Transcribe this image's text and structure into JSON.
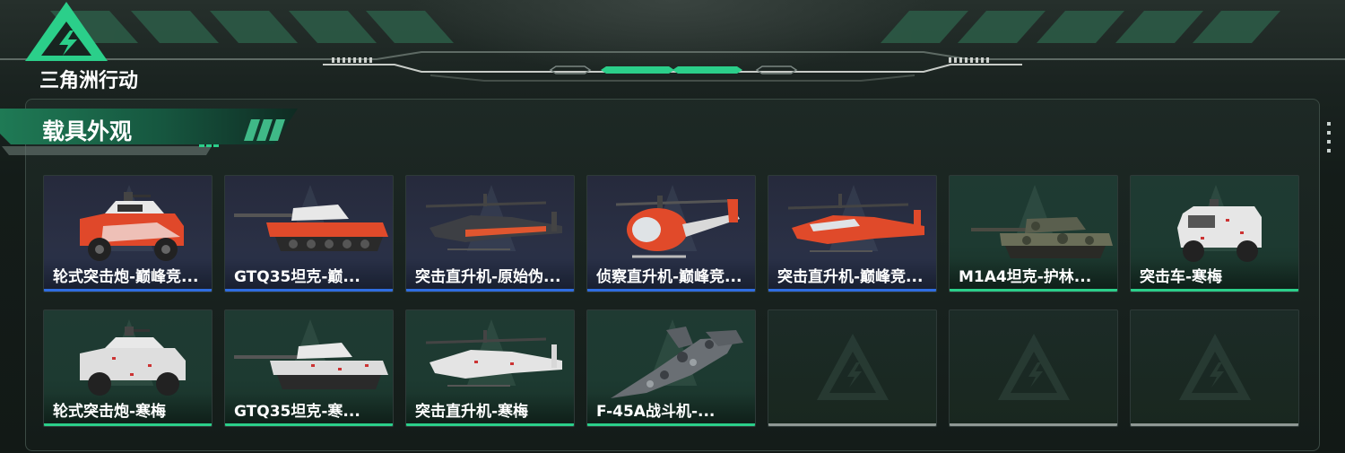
{
  "app": {
    "logo_text": "三角洲行动",
    "logo_icon": "delta-triangle-lightning-icon"
  },
  "section": {
    "title": "载具外观"
  },
  "colors": {
    "accent_green": "#2bcf8a",
    "rarity_blue": "#2f6de0",
    "empty_gray": "#8f9894"
  },
  "vehicles": [
    {
      "label": "轮式突击炮-巅峰竞...",
      "rarity": "blue",
      "icon": "armored-car-orange-icon"
    },
    {
      "label": "GTQ35坦克-巅...",
      "rarity": "blue",
      "icon": "tank-orange-icon"
    },
    {
      "label": "突击直升机-原始伪...",
      "rarity": "blue",
      "icon": "attack-helicopter-dark-icon"
    },
    {
      "label": "侦察直升机-巅峰竞...",
      "rarity": "blue",
      "icon": "scout-helicopter-orange-icon"
    },
    {
      "label": "突击直升机-巅峰竞...",
      "rarity": "blue",
      "icon": "attack-helicopter-orange-icon"
    },
    {
      "label": "M1A4坦克-护林...",
      "rarity": "green",
      "icon": "tank-camo-icon"
    },
    {
      "label": "突击车-寒梅",
      "rarity": "green",
      "icon": "assault-vehicle-white-icon"
    },
    {
      "label": "轮式突击炮-寒梅",
      "rarity": "green",
      "icon": "armored-car-white-icon"
    },
    {
      "label": "GTQ35坦克-寒...",
      "rarity": "green",
      "icon": "tank-white-icon"
    },
    {
      "label": "突击直升机-寒梅",
      "rarity": "green",
      "icon": "attack-helicopter-white-icon"
    },
    {
      "label": "F-45A战斗机-...",
      "rarity": "green",
      "icon": "fighter-jet-camo-icon"
    },
    {
      "label": "",
      "rarity": "empty",
      "icon": "empty-slot-icon"
    },
    {
      "label": "",
      "rarity": "empty",
      "icon": "empty-slot-icon"
    },
    {
      "label": "",
      "rarity": "empty",
      "icon": "empty-slot-icon"
    }
  ]
}
